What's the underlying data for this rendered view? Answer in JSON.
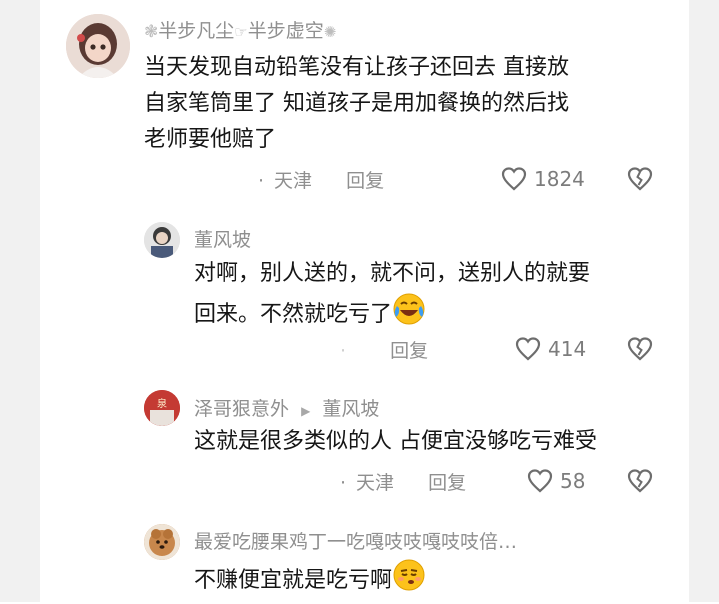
{
  "comments": [
    {
      "author": "半步凡尘",
      "author_suffix": "半步虚空",
      "lines": [
        "当天发现自动铅笔没有让孩子还回去 直接放",
        "自家笔筒里了 知道孩子是用加餐换的然后找",
        "老师要他赔了"
      ],
      "location": "天津",
      "reply": "回复",
      "likes": "1824"
    },
    {
      "author": "董风坡",
      "lines": [
        "对啊，别人送的，就不问，送别人的就要",
        "回来。不然就吃亏了"
      ],
      "location": "",
      "reply": "回复",
      "likes": "414",
      "emoji": "crying-laughing-emoji"
    },
    {
      "author": "泽哥狠意外",
      "reply_to": "董风坡",
      "lines": [
        "这就是很多类似的人 占便宜没够吃亏难受"
      ],
      "location": "天津",
      "reply": "回复",
      "likes": "58"
    },
    {
      "author": "最爱吃腰果鸡丁一吃嘎吱吱嘎吱吱倍…",
      "lines": [
        "不赚便宜就是吃亏啊"
      ],
      "emoji": "smug-emoji"
    }
  ],
  "separator": "·",
  "icons": {
    "like": "heart-icon",
    "dislike": "broken-heart-icon",
    "reply_arrow": "right-triangle-icon"
  },
  "colors": {
    "text": "#161616",
    "muted": "#8f8f8f"
  }
}
